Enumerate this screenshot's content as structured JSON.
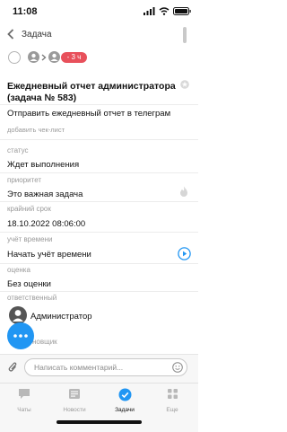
{
  "statusbar": {
    "time": "11:08"
  },
  "nav": {
    "back_label": "Задача"
  },
  "toolbar": {
    "badge": "- 3 ч"
  },
  "task": {
    "title": "Ежедневный отчет администратора (задача № 583)",
    "subtitle": "Отправить ежедневный отчет в телеграм",
    "add_checklist": "добавить чек-лист"
  },
  "fields": {
    "status_label": "статус",
    "status_value": "Ждет выполнения",
    "priority_label": "приоритет",
    "priority_value": "Это важная задача",
    "deadline_label": "крайний срок",
    "deadline_value": "18.10.2022 08:06:00",
    "time_label": "учёт времени",
    "time_value": "Начать учёт времени",
    "rating_label": "оценка",
    "rating_value": "Без оценки",
    "responsible_label": "ответственный",
    "responsible_value": "Администратор",
    "creator_label_partial": "новщик"
  },
  "comment": {
    "placeholder": "Написать комментарий..."
  },
  "tabs": [
    {
      "label": "Чаты",
      "icon": "chat-icon",
      "active": false
    },
    {
      "label": "Новости",
      "icon": "news-icon",
      "active": false
    },
    {
      "label": "Задачи",
      "icon": "check-circle-icon",
      "active": true
    },
    {
      "label": "Еще",
      "icon": "more-grid-icon",
      "active": false
    }
  ],
  "colors": {
    "accent": "#2196f3",
    "badge": "#e8505b",
    "muted": "#9a9a9a"
  }
}
